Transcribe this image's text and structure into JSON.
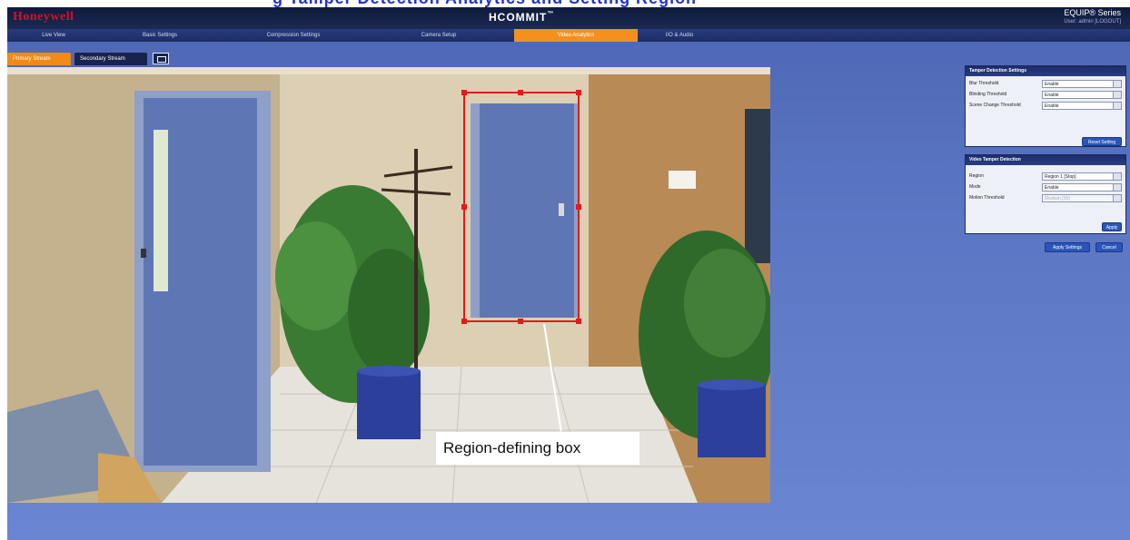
{
  "page": {
    "caption": "g Tamper Detection Analytics and Setting Region"
  },
  "header": {
    "logo": "Honeywell",
    "product": "HCOMMIT",
    "product_tm": "™",
    "series": "EQUIP® Series",
    "series_sub": "User: admin [LOGOUT]"
  },
  "nav": {
    "items": [
      {
        "label": "Live View",
        "active": false
      },
      {
        "label": "Basic Settings",
        "active": false
      },
      {
        "label": "Compression Settings",
        "active": false
      },
      {
        "label": "Camera Setup",
        "active": false
      },
      {
        "label": "Video Analytics",
        "active": true
      },
      {
        "label": "I/O & Audio",
        "active": false
      }
    ]
  },
  "stream": {
    "primary_label": "Primary Stream",
    "secondary_label": "Secondary Stream",
    "snapshot_icon": "camera-snapshot-icon"
  },
  "annotation": {
    "callout": "Region-defining box"
  },
  "tamper_panel": {
    "title": "Tamper Detection Settings",
    "rows": [
      {
        "label": "Blur Threshold",
        "value": "Enable"
      },
      {
        "label": "Blinding Threshold",
        "value": "Enable"
      },
      {
        "label": "Scene Change Threshold",
        "value": "Enable"
      }
    ],
    "button": "Reset Setting"
  },
  "region_panel": {
    "title": "Video Tamper Detection",
    "rows": [
      {
        "label": "Region",
        "value": "Region 1 [Stop]",
        "disabled": false
      },
      {
        "label": "Mode",
        "value": "Enable",
        "disabled": false
      },
      {
        "label": "Motion Threshold",
        "value": "Medium (50)",
        "disabled": true
      }
    ],
    "button": "Apply"
  },
  "footer": {
    "apply_all": "Apply Settings",
    "cancel": "Cancel"
  },
  "colors": {
    "accent": "#f5901e",
    "brand_red": "#d8102a",
    "region_box": "#e21a1a",
    "background": "#5b77c4",
    "header": "#0f1a3a"
  }
}
